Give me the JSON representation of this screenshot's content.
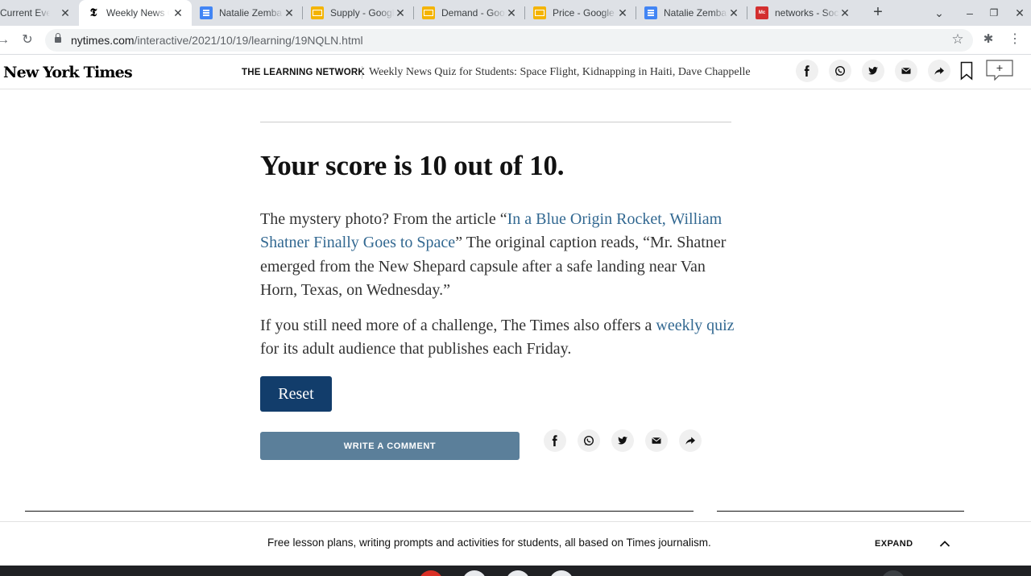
{
  "browser": {
    "tabs": [
      {
        "title": "Current Event",
        "icon": "nyt-icon",
        "active": false
      },
      {
        "title": "Weekly News Quiz",
        "icon": "nyt-icon",
        "active": true
      },
      {
        "title": "Natalie Zemba",
        "icon": "docs-icon",
        "active": false
      },
      {
        "title": "Supply - Google",
        "icon": "slides-icon",
        "active": false
      },
      {
        "title": "Demand - Goo",
        "icon": "slides-icon",
        "active": false
      },
      {
        "title": "Price - Google",
        "icon": "slides-icon",
        "active": false
      },
      {
        "title": "Natalie Zemba",
        "icon": "docs-icon",
        "active": false
      },
      {
        "title": "networks - Soc",
        "icon": "mcgraw-hill-icon",
        "active": false
      }
    ],
    "url_host": "nytimes.com",
    "url_path": "/interactive/2021/10/19/learning/19NQLN.html"
  },
  "header": {
    "logo": "New York Times",
    "section": "THE LEARNING NETWORK",
    "headline": "Weekly News Quiz for Students: Space Flight, Kidnapping in Haiti, Dave Chappelle"
  },
  "article": {
    "score_text": "Your score is 10 out of 10.",
    "p1_before": "The mystery photo? From the article “",
    "p1_link": "In a Blue Origin Rocket, William Shatner Finally Goes to Space",
    "p1_after": "” The original caption reads, “Mr. Shatner emerged from the New Shepard capsule after a safe landing near Van Horn, Texas, on Wednesday.”",
    "p2_before": "If you still need more of a challenge, The Times also offers a ",
    "p2_link": "weekly quiz",
    "p2_after": " for its adult audience that publishes each Friday.",
    "reset_label": "Reset",
    "write_comment_label": "WRITE A COMMENT"
  },
  "promo": {
    "text": "Free lesson plans, writing prompts and activities for students, all based on Times journalism.",
    "expand_label": "EXPAND"
  },
  "colors": {
    "link": "#326891",
    "reset_button": "#123d6b",
    "comment_button": "#5b7f9a"
  }
}
